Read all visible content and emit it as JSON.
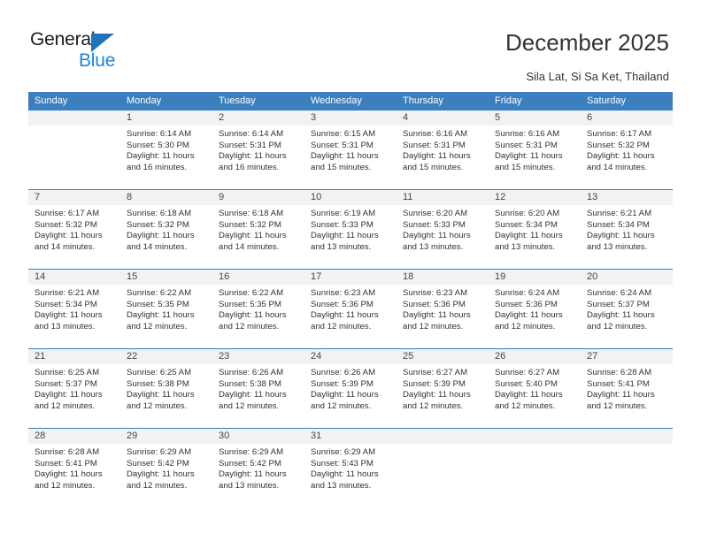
{
  "brand": {
    "name_top": "General",
    "name_bottom": "Blue",
    "triangle_color": "#1f72bd",
    "blue_color": "#1f86d8"
  },
  "header": {
    "title": "December 2025",
    "subtitle": "Sila Lat, Si Sa Ket, Thailand"
  },
  "theme": {
    "header_blue": "#3b7fbe",
    "daynum_band": "#f2f2f2",
    "text": "#333333"
  },
  "weekdays": [
    "Sunday",
    "Monday",
    "Tuesday",
    "Wednesday",
    "Thursday",
    "Friday",
    "Saturday"
  ],
  "weeks": [
    [
      {
        "day": "",
        "sunrise": "",
        "sunset": "",
        "daylight1": "",
        "daylight2": "",
        "empty": true
      },
      {
        "day": "1",
        "sunrise": "Sunrise: 6:14 AM",
        "sunset": "Sunset: 5:30 PM",
        "daylight1": "Daylight: 11 hours",
        "daylight2": "and 16 minutes."
      },
      {
        "day": "2",
        "sunrise": "Sunrise: 6:14 AM",
        "sunset": "Sunset: 5:31 PM",
        "daylight1": "Daylight: 11 hours",
        "daylight2": "and 16 minutes."
      },
      {
        "day": "3",
        "sunrise": "Sunrise: 6:15 AM",
        "sunset": "Sunset: 5:31 PM",
        "daylight1": "Daylight: 11 hours",
        "daylight2": "and 15 minutes."
      },
      {
        "day": "4",
        "sunrise": "Sunrise: 6:16 AM",
        "sunset": "Sunset: 5:31 PM",
        "daylight1": "Daylight: 11 hours",
        "daylight2": "and 15 minutes."
      },
      {
        "day": "5",
        "sunrise": "Sunrise: 6:16 AM",
        "sunset": "Sunset: 5:31 PM",
        "daylight1": "Daylight: 11 hours",
        "daylight2": "and 15 minutes."
      },
      {
        "day": "6",
        "sunrise": "Sunrise: 6:17 AM",
        "sunset": "Sunset: 5:32 PM",
        "daylight1": "Daylight: 11 hours",
        "daylight2": "and 14 minutes."
      }
    ],
    [
      {
        "day": "7",
        "sunrise": "Sunrise: 6:17 AM",
        "sunset": "Sunset: 5:32 PM",
        "daylight1": "Daylight: 11 hours",
        "daylight2": "and 14 minutes."
      },
      {
        "day": "8",
        "sunrise": "Sunrise: 6:18 AM",
        "sunset": "Sunset: 5:32 PM",
        "daylight1": "Daylight: 11 hours",
        "daylight2": "and 14 minutes."
      },
      {
        "day": "9",
        "sunrise": "Sunrise: 6:18 AM",
        "sunset": "Sunset: 5:32 PM",
        "daylight1": "Daylight: 11 hours",
        "daylight2": "and 14 minutes."
      },
      {
        "day": "10",
        "sunrise": "Sunrise: 6:19 AM",
        "sunset": "Sunset: 5:33 PM",
        "daylight1": "Daylight: 11 hours",
        "daylight2": "and 13 minutes."
      },
      {
        "day": "11",
        "sunrise": "Sunrise: 6:20 AM",
        "sunset": "Sunset: 5:33 PM",
        "daylight1": "Daylight: 11 hours",
        "daylight2": "and 13 minutes."
      },
      {
        "day": "12",
        "sunrise": "Sunrise: 6:20 AM",
        "sunset": "Sunset: 5:34 PM",
        "daylight1": "Daylight: 11 hours",
        "daylight2": "and 13 minutes."
      },
      {
        "day": "13",
        "sunrise": "Sunrise: 6:21 AM",
        "sunset": "Sunset: 5:34 PM",
        "daylight1": "Daylight: 11 hours",
        "daylight2": "and 13 minutes."
      }
    ],
    [
      {
        "day": "14",
        "sunrise": "Sunrise: 6:21 AM",
        "sunset": "Sunset: 5:34 PM",
        "daylight1": "Daylight: 11 hours",
        "daylight2": "and 13 minutes."
      },
      {
        "day": "15",
        "sunrise": "Sunrise: 6:22 AM",
        "sunset": "Sunset: 5:35 PM",
        "daylight1": "Daylight: 11 hours",
        "daylight2": "and 12 minutes."
      },
      {
        "day": "16",
        "sunrise": "Sunrise: 6:22 AM",
        "sunset": "Sunset: 5:35 PM",
        "daylight1": "Daylight: 11 hours",
        "daylight2": "and 12 minutes."
      },
      {
        "day": "17",
        "sunrise": "Sunrise: 6:23 AM",
        "sunset": "Sunset: 5:36 PM",
        "daylight1": "Daylight: 11 hours",
        "daylight2": "and 12 minutes."
      },
      {
        "day": "18",
        "sunrise": "Sunrise: 6:23 AM",
        "sunset": "Sunset: 5:36 PM",
        "daylight1": "Daylight: 11 hours",
        "daylight2": "and 12 minutes."
      },
      {
        "day": "19",
        "sunrise": "Sunrise: 6:24 AM",
        "sunset": "Sunset: 5:36 PM",
        "daylight1": "Daylight: 11 hours",
        "daylight2": "and 12 minutes."
      },
      {
        "day": "20",
        "sunrise": "Sunrise: 6:24 AM",
        "sunset": "Sunset: 5:37 PM",
        "daylight1": "Daylight: 11 hours",
        "daylight2": "and 12 minutes."
      }
    ],
    [
      {
        "day": "21",
        "sunrise": "Sunrise: 6:25 AM",
        "sunset": "Sunset: 5:37 PM",
        "daylight1": "Daylight: 11 hours",
        "daylight2": "and 12 minutes."
      },
      {
        "day": "22",
        "sunrise": "Sunrise: 6:25 AM",
        "sunset": "Sunset: 5:38 PM",
        "daylight1": "Daylight: 11 hours",
        "daylight2": "and 12 minutes."
      },
      {
        "day": "23",
        "sunrise": "Sunrise: 6:26 AM",
        "sunset": "Sunset: 5:38 PM",
        "daylight1": "Daylight: 11 hours",
        "daylight2": "and 12 minutes."
      },
      {
        "day": "24",
        "sunrise": "Sunrise: 6:26 AM",
        "sunset": "Sunset: 5:39 PM",
        "daylight1": "Daylight: 11 hours",
        "daylight2": "and 12 minutes."
      },
      {
        "day": "25",
        "sunrise": "Sunrise: 6:27 AM",
        "sunset": "Sunset: 5:39 PM",
        "daylight1": "Daylight: 11 hours",
        "daylight2": "and 12 minutes."
      },
      {
        "day": "26",
        "sunrise": "Sunrise: 6:27 AM",
        "sunset": "Sunset: 5:40 PM",
        "daylight1": "Daylight: 11 hours",
        "daylight2": "and 12 minutes."
      },
      {
        "day": "27",
        "sunrise": "Sunrise: 6:28 AM",
        "sunset": "Sunset: 5:41 PM",
        "daylight1": "Daylight: 11 hours",
        "daylight2": "and 12 minutes."
      }
    ],
    [
      {
        "day": "28",
        "sunrise": "Sunrise: 6:28 AM",
        "sunset": "Sunset: 5:41 PM",
        "daylight1": "Daylight: 11 hours",
        "daylight2": "and 12 minutes."
      },
      {
        "day": "29",
        "sunrise": "Sunrise: 6:29 AM",
        "sunset": "Sunset: 5:42 PM",
        "daylight1": "Daylight: 11 hours",
        "daylight2": "and 12 minutes."
      },
      {
        "day": "30",
        "sunrise": "Sunrise: 6:29 AM",
        "sunset": "Sunset: 5:42 PM",
        "daylight1": "Daylight: 11 hours",
        "daylight2": "and 13 minutes."
      },
      {
        "day": "31",
        "sunrise": "Sunrise: 6:29 AM",
        "sunset": "Sunset: 5:43 PM",
        "daylight1": "Daylight: 11 hours",
        "daylight2": "and 13 minutes."
      },
      {
        "day": "",
        "sunrise": "",
        "sunset": "",
        "daylight1": "",
        "daylight2": "",
        "empty": true
      },
      {
        "day": "",
        "sunrise": "",
        "sunset": "",
        "daylight1": "",
        "daylight2": "",
        "empty": true
      },
      {
        "day": "",
        "sunrise": "",
        "sunset": "",
        "daylight1": "",
        "daylight2": "",
        "empty": true
      }
    ]
  ]
}
